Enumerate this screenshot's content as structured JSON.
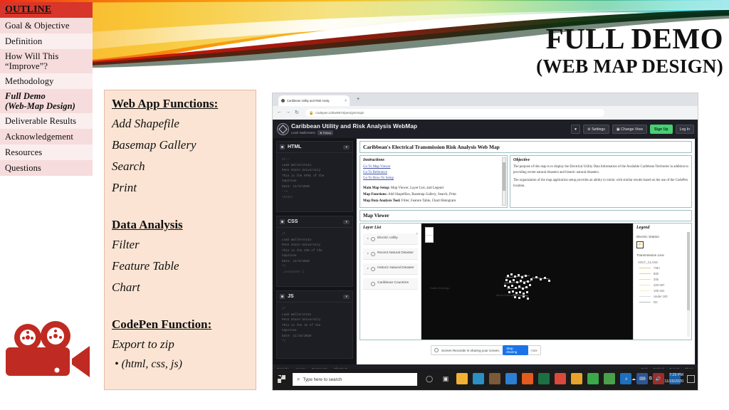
{
  "slide": {
    "title_main": "FULL DEMO",
    "title_sub": "(WEB MAP DESIGN)",
    "camera_icon": "movie-camera-icon"
  },
  "outline": {
    "header": "OUTLINE",
    "items": [
      {
        "label": "Goal & Objective"
      },
      {
        "label": "Definition"
      },
      {
        "label": "How Will This",
        "label2": "“Improve”?"
      },
      {
        "label": "Methodology"
      },
      {
        "label": "Full Demo",
        "label2": "(Web-Map Design)",
        "active": true
      },
      {
        "label": "Deliverable Results"
      },
      {
        "label": "Acknowledgement"
      },
      {
        "label": "Resources"
      },
      {
        "label": "Questions"
      }
    ]
  },
  "card": {
    "heading1": "Web App Functions:",
    "list1": [
      "Add Shapefile",
      "Basemap Gallery",
      "Search",
      "Print"
    ],
    "heading2": "Data Analysis",
    "list2": [
      "Filter",
      "Feature Table",
      "Chart"
    ],
    "heading3": "CodePen Function:",
    "list3": [
      "Export  to zip"
    ],
    "bullet": "•  (html, css, js)"
  },
  "screenshot": {
    "browser": {
      "tab_title": "Caribbean Utility and Risk Analy",
      "tab_close": "×",
      "new_tab": "+",
      "back": "←",
      "forward": "→",
      "reload": "↻",
      "lock_icon": "lock-icon",
      "url": "codepen.io/lrw0974/pen/gOnXqD"
    },
    "codepen": {
      "logo": "codepen-logo-icon",
      "pen_title": "Caribbean Utility and Risk Analysis WebMap",
      "user": "Leah Wallerstein",
      "follow": "★ Follow",
      "actions": [
        "♥",
        "⚙ Settings",
        "▣ Change View",
        "Sign Up",
        "Log In"
      ],
      "panes": [
        {
          "name": "HTML",
          "code": [
            "<!--",
            "Leah Wallerstein",
            "Penn State University",
            "This is the HTML of the",
            "Capstone",
            "Date: 11/9/2020",
            "-->",
            "<html>"
          ]
        },
        {
          "name": "CSS",
          "code": [
            "/*",
            "Leah Wallerstein",
            "Penn State University",
            "This is the CSS of the",
            "Capstone",
            "Date: 11/9/2020",
            "*/",
            ".container {"
          ]
        },
        {
          "name": "JS",
          "code": [
            "/*",
            "Leah Wallerstein",
            "Penn State University",
            "This is the JS of the",
            "Capstone",
            "Date: 11/15/2020",
            "*/"
          ]
        }
      ],
      "footer_left": [
        "Console",
        "Assets",
        "Comments",
        "Shortcuts"
      ],
      "footer_right": [
        "Fork",
        "Embed",
        "Export",
        "Share"
      ]
    },
    "preview": {
      "page_title": "Caribbean's Electrical Transmission Risk Analysis Web Map",
      "instructions": {
        "heading": "Instructions",
        "links": [
          "Go To Map Viewer",
          "Go To Reference",
          "Go To How-To Setup"
        ],
        "rows": [
          {
            "key": "Main Map Setup:",
            "value": "Map Viewer, Layer List, and Legend"
          },
          {
            "key": "Map Functions:",
            "value": "Add Shapefiles, Basemap Gallery, Search, Print"
          },
          {
            "key": "Map Data Analysis Tool:",
            "value": "Filter, Feature Table, Chart Histogram"
          }
        ]
      },
      "objective": {
        "heading": "Objective",
        "paragraphs": [
          "The purpose of this map is to display the Electrical Utility Data Information of the Available Caribbean Territories in addition to providing recent natural disasters and historic natural disasters.",
          "The organization of the map application setup provides an ability to mimic with similar results based on the use of the CodePen location."
        ]
      },
      "map_viewer_heading": "Map Viewer",
      "layer_list": {
        "heading": "Layer List",
        "close": "×",
        "items": [
          "Electric Utility",
          "Recent Natural Disaster",
          "Historic Natural Disaster",
          "Caribbean Countries"
        ]
      },
      "map": {
        "zoom_in": "+",
        "zoom_out": "−",
        "labels": [
          "Santo Domingo",
          "Mona Passage"
        ]
      },
      "legend": {
        "heading": "Legend",
        "section1": "Electric Station",
        "symbol1": "⚡",
        "section2": "Transmission Line",
        "field": "VOLT_CLASS",
        "classes": [
          {
            "label": "735+",
            "color": "#d9c98a"
          },
          {
            "label": "500",
            "color": "#e0cf94"
          },
          {
            "label": "345",
            "color": "#e8dba8"
          },
          {
            "label": "220-287",
            "color": "#efe6bb"
          },
          {
            "label": "100-161",
            "color": "#f5eecd"
          },
          {
            "label": "Under 100",
            "color": "#dcdcdc"
          },
          {
            "label": "DC",
            "color": "#b9b9b9"
          }
        ]
      }
    },
    "share_notification": {
      "icon": "screen-share-icon",
      "text": "Screen Recorder is sharing your screen.",
      "stop_label": "Stop sharing",
      "hide_label": "Hide"
    },
    "taskbar": {
      "start_icon": "windows-start-icon",
      "search_icon": "search-icon",
      "search_placeholder": "Type here to search",
      "icons": [
        "cortana-icon",
        "task-view-icon",
        "file-explorer-icon",
        "edge-icon",
        "store-icon",
        "mail-icon",
        "firefox-icon",
        "excel-icon",
        "chrome-icon",
        "notes-icon",
        "maps-icon",
        "teams-icon",
        "skype-icon",
        "word-icon",
        "arcgis-icon",
        "outlook-icon"
      ],
      "tray": [
        "∧",
        "☁",
        "⌨",
        "⧉",
        "🔊"
      ],
      "time": "7:29 PM",
      "date": "11/15/2020",
      "notification_icon": "notification-icon"
    }
  },
  "colors": {
    "outline_header": "#d8362a",
    "outline_row_a": "#f6dcdc",
    "outline_row_b": "#fbeeee",
    "card_bg": "#fbe4d3",
    "card_border": "#e8b9a6",
    "camera": "#bf2b22",
    "signup_green": "#47cf73",
    "share_blue": "#1a73e8"
  }
}
